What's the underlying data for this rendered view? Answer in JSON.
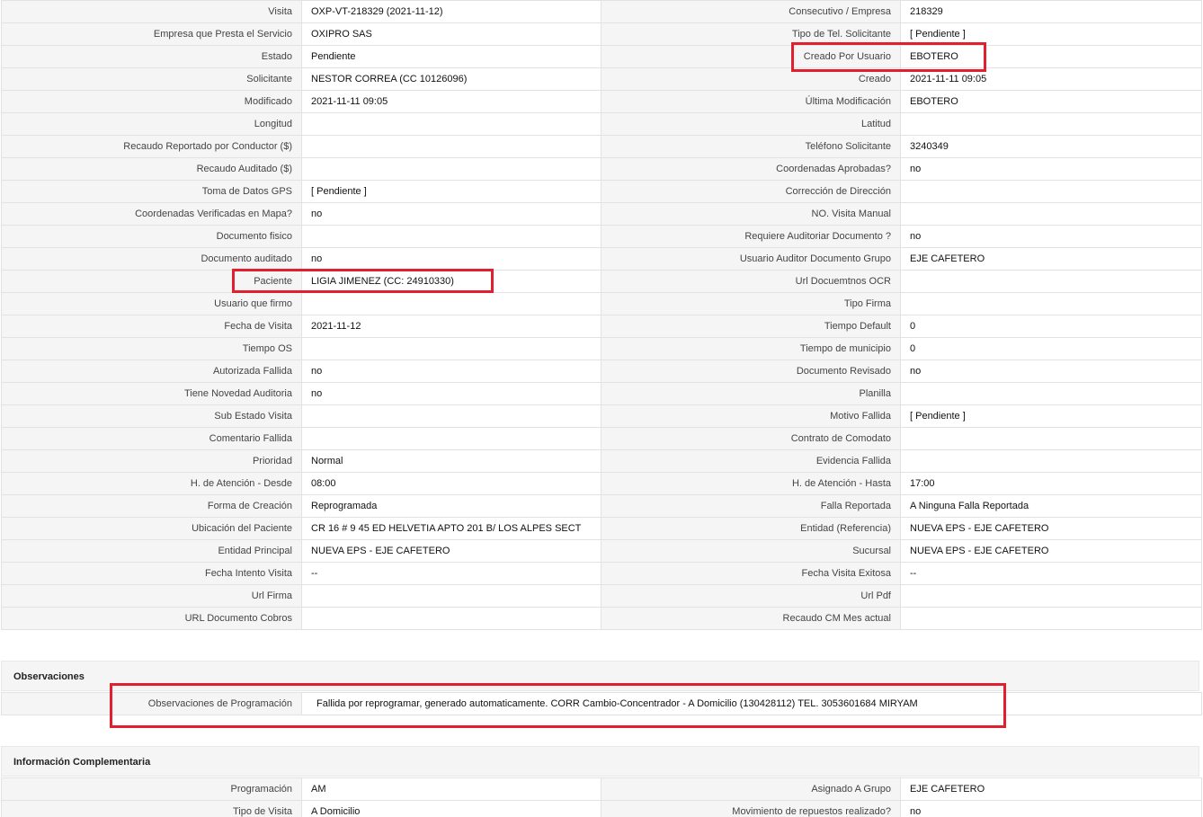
{
  "main_rows": [
    [
      "Visita",
      "OXP-VT-218329 (2021-11-12)",
      "Consecutivo / Empresa",
      "218329"
    ],
    [
      "Empresa que Presta el Servicio",
      "OXIPRO SAS",
      "Tipo de Tel. Solicitante",
      "[ Pendiente ]"
    ],
    [
      "Estado",
      "Pendiente",
      "Creado Por Usuario",
      "EBOTERO"
    ],
    [
      "Solicitante",
      "NESTOR CORREA (CC 10126096)",
      "Creado",
      "2021-11-11 09:05"
    ],
    [
      "Modificado",
      "2021-11-11 09:05",
      "Última Modificación",
      " EBOTERO"
    ],
    [
      "Longitud",
      "",
      "Latitud",
      ""
    ],
    [
      "Recaudo Reportado por Conductor ($)",
      "",
      "Teléfono Solicitante",
      "3240349"
    ],
    [
      "Recaudo Auditado ($)",
      "",
      "Coordenadas Aprobadas?",
      " no"
    ],
    [
      "Toma de Datos GPS",
      "[ Pendiente ]",
      "Corrección de Dirección",
      ""
    ],
    [
      "Coordenadas Verificadas en Mapa?",
      " no",
      "NO. Visita Manual",
      ""
    ],
    [
      "Documento fisico",
      "",
      "Requiere Auditoriar Documento ?",
      " no"
    ],
    [
      "Documento auditado",
      " no",
      "Usuario Auditor Documento Grupo",
      "EJE CAFETERO"
    ],
    [
      "Paciente",
      "LIGIA JIMENEZ (CC: 24910330)",
      "Url Docuemtnos OCR",
      ""
    ],
    [
      "Usuario que firmo",
      "",
      "Tipo Firma",
      ""
    ],
    [
      "Fecha de Visita",
      " 2021-11-12",
      "Tiempo Default",
      "0"
    ],
    [
      "Tiempo OS",
      "",
      "Tiempo de municipio",
      "0"
    ],
    [
      "Autorizada Fallida",
      " no",
      "Documento Revisado",
      " no"
    ],
    [
      "Tiene Novedad Auditoria",
      " no",
      "Planilla",
      ""
    ],
    [
      "Sub Estado Visita",
      "",
      "Motivo Fallida",
      "[ Pendiente ]"
    ],
    [
      "Comentario Fallida",
      "",
      "Contrato de Comodato",
      ""
    ],
    [
      "Prioridad",
      "Normal",
      "Evidencia Fallida",
      ""
    ],
    [
      "H. de Atención - Desde",
      "08:00",
      "H. de Atención - Hasta",
      "17:00"
    ],
    [
      "Forma de Creación",
      "Reprogramada",
      "Falla Reportada",
      "A Ninguna Falla Reportada"
    ],
    [
      "Ubicación del Paciente",
      "CR 16 # 9 45 ED HELVETIA APTO 201 B/ LOS ALPES SECT",
      "Entidad (Referencia)",
      "NUEVA EPS - EJE CAFETERO"
    ],
    [
      "Entidad Principal",
      "NUEVA EPS - EJE CAFETERO",
      "Sucursal",
      "NUEVA EPS - EJE CAFETERO"
    ],
    [
      "Fecha Intento Visita",
      " --",
      "Fecha Visita Exitosa",
      " --"
    ],
    [
      "Url Firma",
      "",
      "Url Pdf",
      ""
    ],
    [
      "URL Documento Cobros",
      "",
      "Recaudo CM Mes actual",
      ""
    ]
  ],
  "observaciones": {
    "title": "Observaciones",
    "label": "Observaciones de Programación",
    "value": "Fallida por reprogramar, generado automaticamente. CORR Cambio-Concentrador - A Domicilio (130428112) TEL. 3053601684 MIRYAM"
  },
  "info": {
    "title": "Información Complementaria",
    "rows": [
      [
        "Programación",
        "AM",
        "Asignado A Grupo",
        "EJE CAFETERO"
      ],
      [
        "Tipo de Visita",
        "A Domicilio",
        "Movimiento de repuestos realizado?",
        " no"
      ]
    ]
  },
  "colors": {
    "label_bg": "#f5f5f5",
    "border": "#e2e2e2",
    "highlight": "#e0202e"
  }
}
